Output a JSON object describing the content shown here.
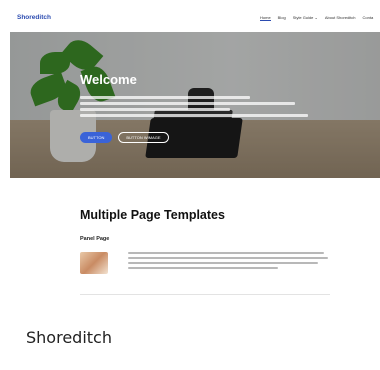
{
  "site": {
    "logo": "Shoreditch",
    "nav": [
      "Home",
      "Blog",
      "Style Guide ⌄",
      "About Shoreditch",
      "Conta"
    ]
  },
  "hero": {
    "title": "Welcome",
    "primary_button": "BUTTON",
    "secondary_button": "BUTTON WIMAGE"
  },
  "content": {
    "title": "Multiple Page Templates",
    "panel_heading": "Panel Page"
  },
  "caption": "Shoreditch"
}
